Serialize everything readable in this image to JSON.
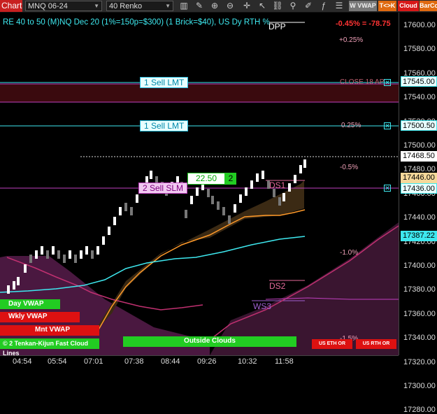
{
  "toolbar": {
    "title": "Chart",
    "instrument": "MNQ 06-24",
    "bar_type": "40 Renko",
    "icons": [
      "bar-style-icon",
      "drawing-tools-icon",
      "zoom-in-icon",
      "zoom-out-icon",
      "crosshair-icon",
      "arrow-icon",
      "link-icon",
      "pin-icon",
      "edit-icon",
      "indicators-icon",
      "strategies-icon",
      "data-box-icon",
      "properties-icon"
    ],
    "wvwap_label": "W VWAP",
    "tk_label": "T<>K",
    "cloud_label": "Cloud",
    "barco_label": "BarCo"
  },
  "chart": {
    "header": "RE 40 to 50 (M)NQ Dec 20 (1%=150p=$300) (1 Brick=$40), US Dy RTH %",
    "change_label": "-0.45% = -78.75",
    "dpp_label": "DPP",
    "close_label": "CLOSE 18 AP",
    "pct_labels": [
      "+0.25%",
      "0.25%",
      "-0.5%",
      "-1.0%",
      "-1.5%"
    ],
    "orders": {
      "sell_lmt_1": "1 Sell LMT",
      "sell_lmt_2": "1 Sell LMT",
      "sell_slm": "2 Sell SLM"
    },
    "pnl_value": "22.50",
    "pnl_qty": "2",
    "levels": {
      "ds1": "DS1",
      "ds2": "DS2",
      "ws3": "WS3"
    },
    "tags": {
      "day_vwap": "Day VWAP",
      "wkly_vwap": "Wkly VWAP",
      "mnt_vwap": "Mnt VWAP",
      "tenkan_kijun": "Tenkan-Kijun Fast Cloud Lines",
      "copyright": "© 2",
      "outside_clouds": "Outside Clouds",
      "us_eth_or": "US ETH OR",
      "us_rth_or": "US RTH OR"
    }
  },
  "y_axis": {
    "ticks": [
      "17600.00",
      "17580.00",
      "17560.00",
      "17540.00",
      "17520.00",
      "17500.00",
      "17480.00",
      "17460.00",
      "17440.00",
      "17420.00",
      "17400.00",
      "17380.00",
      "17360.00",
      "17340.00",
      "17320.00",
      "17300.00",
      "17280.00"
    ],
    "price_boxes": [
      "17545.00",
      "17500.50",
      "17468.50",
      "17446.00",
      "17436.00",
      "17387.22"
    ]
  },
  "x_axis": {
    "ticks": [
      "04:54",
      "05:54",
      "07:01",
      "07:38",
      "08:44",
      "09:26",
      "10:32",
      "11:58"
    ]
  },
  "colors": {
    "cyan": "#3ee8ef",
    "magenta": "#c040c0",
    "orange": "#ff9a2a",
    "green": "#22cc22",
    "red": "#dd1111"
  }
}
